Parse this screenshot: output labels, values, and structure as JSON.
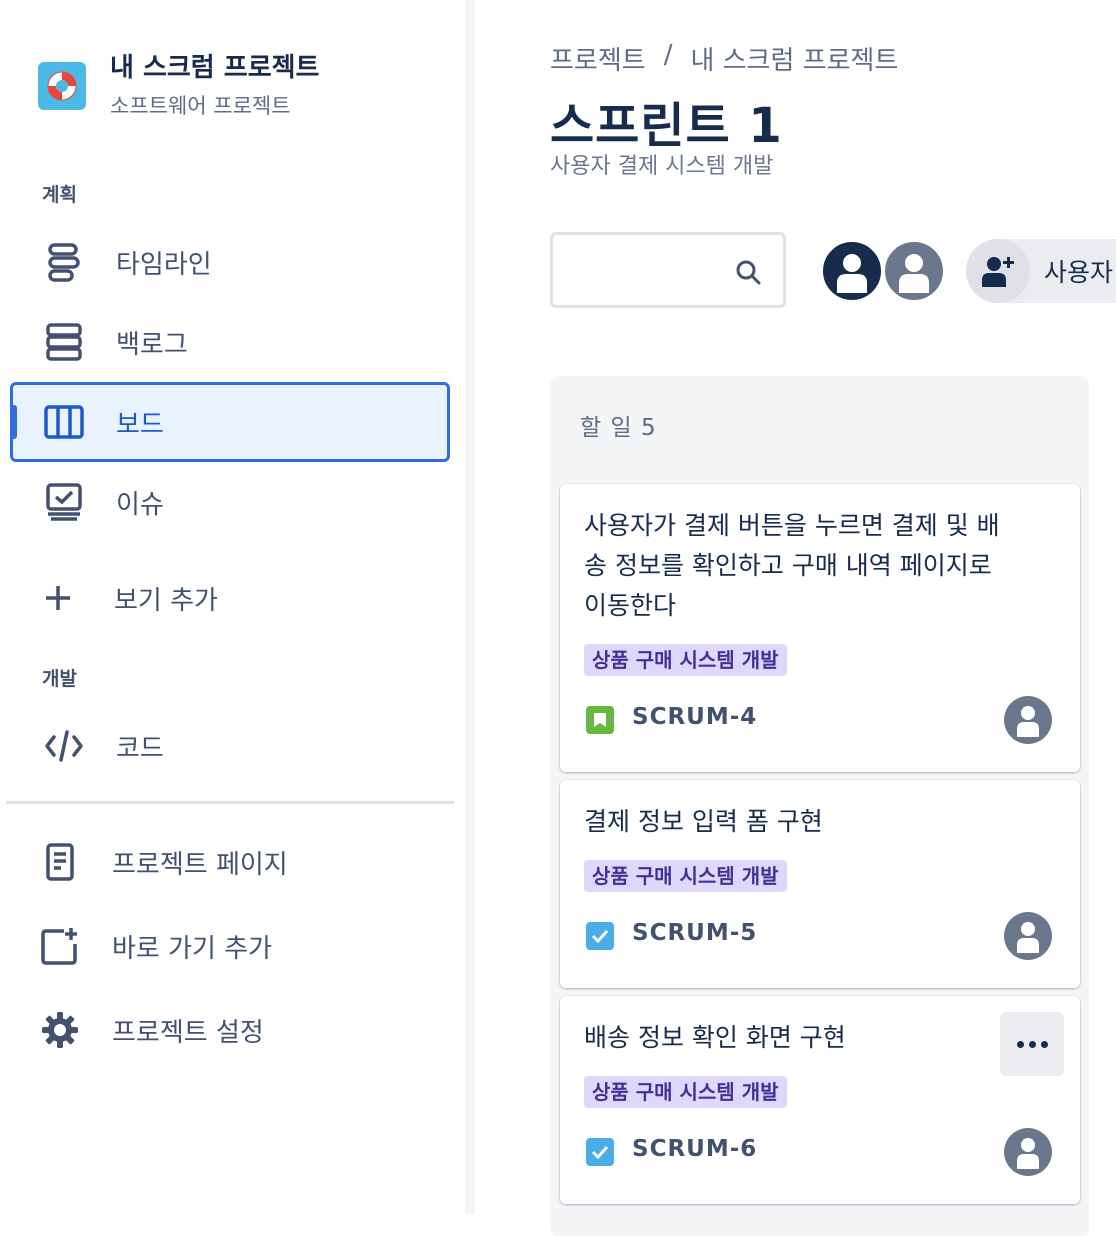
{
  "project": {
    "name": "내 스크럼 프로젝트",
    "type": "소프트웨어 프로젝트",
    "avatar_icon": "lifebuoy-icon"
  },
  "sidebar": {
    "planning_label": "계획",
    "planning_items": [
      {
        "label": "타임라인",
        "icon": "timeline-icon"
      },
      {
        "label": "백로그",
        "icon": "backlog-icon"
      },
      {
        "label": "보드",
        "icon": "board-icon",
        "active": true
      },
      {
        "label": "이슈",
        "icon": "issues-icon"
      },
      {
        "label": "보기 추가",
        "icon": "plus-icon"
      }
    ],
    "dev_label": "개발",
    "dev_items": [
      {
        "label": "코드",
        "icon": "code-icon"
      }
    ],
    "bottom_items": [
      {
        "label": "프로젝트 페이지",
        "icon": "page-icon"
      },
      {
        "label": "바로 가기 추가",
        "icon": "add-shortcut-icon"
      },
      {
        "label": "프로젝트 설정",
        "icon": "gear-icon"
      }
    ]
  },
  "header": {
    "breadcrumb": [
      "프로젝트",
      "/",
      "내 스크럼 프로젝트"
    ],
    "title": "스프린트 1",
    "subtitle": "사용자 결제 시스템 개발"
  },
  "search": {
    "placeholder": ""
  },
  "people": {
    "add_label": "사용자"
  },
  "board": {
    "column": {
      "title": "할 일 5",
      "cards": [
        {
          "title": "사용자가 결제 버튼을 누르면 결제 및 배송 정보를 확인하고 구매 내역 페이지로 이동한다",
          "epic": "상품 구매 시스템 개발",
          "key": "SCRUM-4",
          "type": "story"
        },
        {
          "title": "결제 정보 입력 폼 구현",
          "epic": "상품 구매 시스템 개발",
          "key": "SCRUM-5",
          "type": "task"
        },
        {
          "title": "배송 정보 확인 화면 구현",
          "epic": "상품 구매 시스템 개발",
          "key": "SCRUM-6",
          "type": "task"
        }
      ]
    }
  },
  "colors": {
    "accent": "#2f6fd6",
    "story": "#63ba3c",
    "task": "#4bade8",
    "epic_bg": "#dfd8fd",
    "epic_text": "#403294"
  }
}
